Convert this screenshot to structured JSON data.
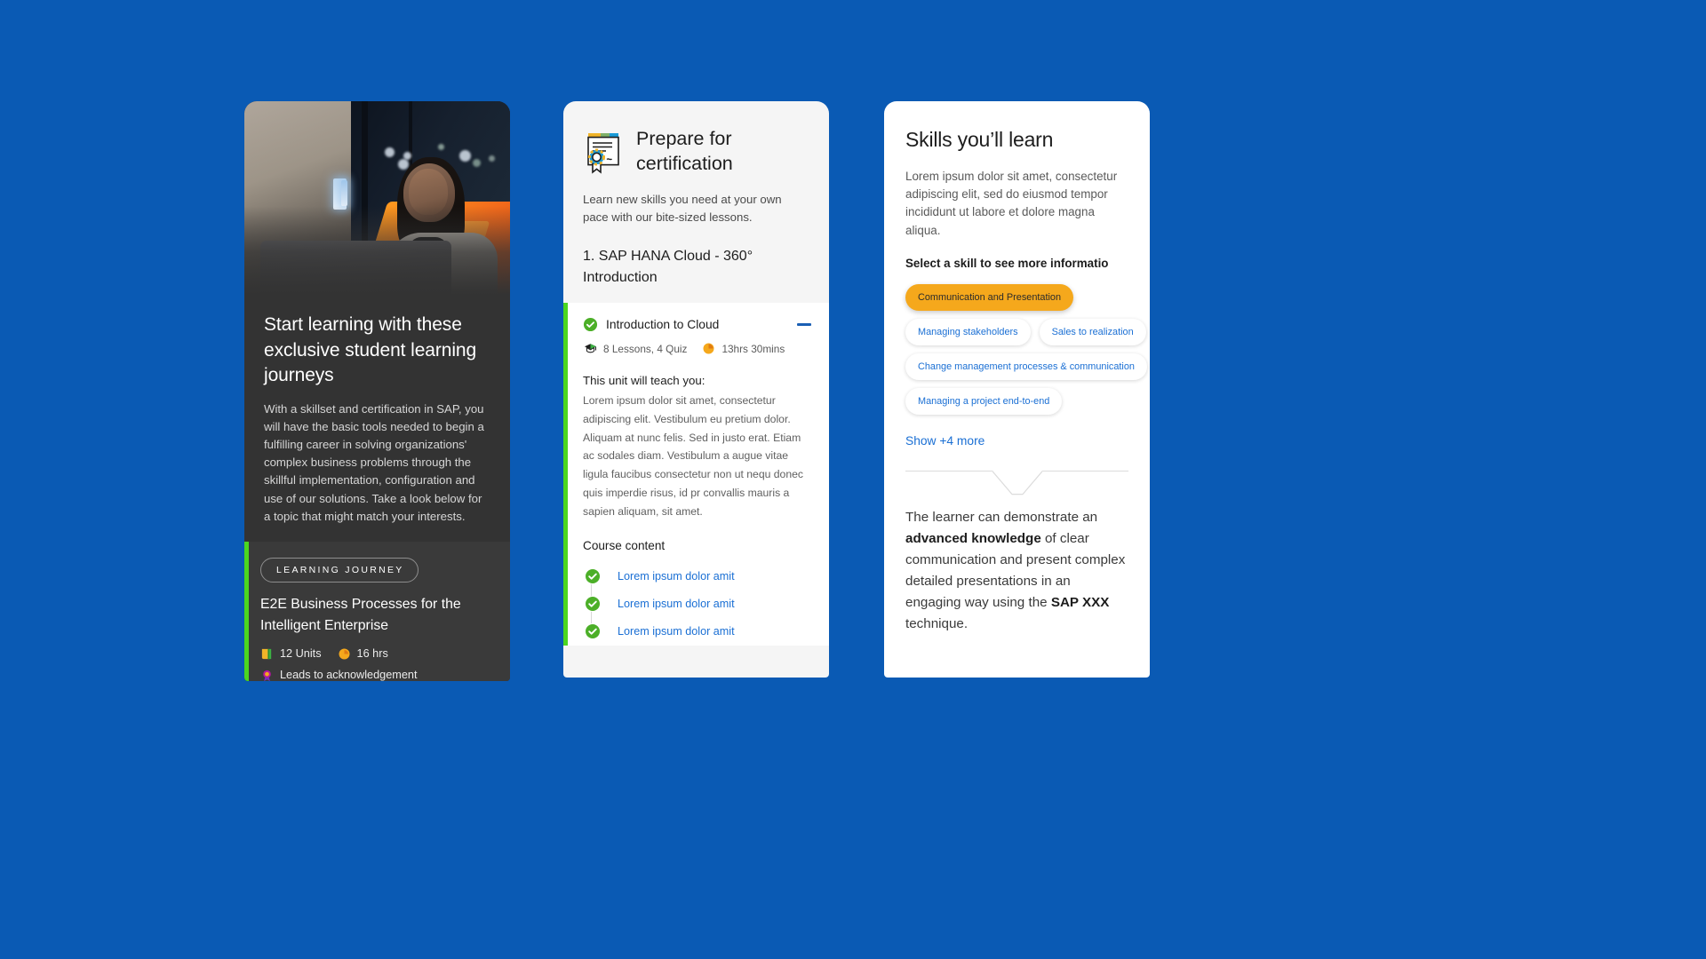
{
  "theme": {
    "background": "#0a5ab4",
    "accent_green": "#4bd61f",
    "link_blue": "#1a6fd4",
    "selected_pill": "#f5a81c",
    "dark_card": "#333333"
  },
  "card_journey": {
    "hero_alt": "student working on laptop at night",
    "title": "Start learning with these exclusive student learning journeys",
    "paragraph": "With a skillset and certification in SAP, you will have the basic tools needed to begin a fulfilling career in solving organizations' complex business problems through the skillful implementation, configuration and use of our solutions. Take a look below for a topic that might match your interests.",
    "badge_label": "LEARNING JOURNEY",
    "journey_title": "E2E Business Processes for the Intelligent Enterprise",
    "units_label": "12 Units",
    "hours_label": "16 hrs",
    "acknowledgement_label": "Leads to acknowledgement"
  },
  "card_certification": {
    "title": "Prepare for certification",
    "subtitle": "Learn new skills you need at your own pace with our bite-sized lessons.",
    "course_number_title": "1. SAP HANA Cloud - 360° Introduction",
    "unit": {
      "name": "Introduction to Cloud",
      "lessons_label": "8 Lessons, 4 Quiz",
      "duration_label": "13hrs 30mins",
      "teach_heading": "This unit will teach you:",
      "teach_body": "Lorem ipsum dolor sit amet, consectetur adipiscing elit. Vestibulum eu pretium dolor. Aliquam at nunc felis. Sed in justo erat. Etiam ac sodales diam. Vestibulum a augue vitae ligula faucibus consectetur non ut nequ donec quis imperdie risus, id pr convallis mauris a sapien aliquam, sit amet.",
      "content_heading": "Course content",
      "content_items": [
        "Lorem ipsum dolor amit",
        "Lorem ipsum dolor amit",
        "Lorem ipsum dolor amit"
      ]
    }
  },
  "card_skills": {
    "title": "Skills you’ll learn",
    "paragraph": "Lorem ipsum dolor sit amet, consectetur adipiscing elit, sed do eiusmod tempor incididunt ut labore et dolore magna aliqua.",
    "select_prompt": "Select a skill to see more informatio",
    "skills": [
      {
        "label": "Communication and Presentation",
        "selected": true
      },
      {
        "label": "Managing stakeholders",
        "selected": false
      },
      {
        "label": "Sales to realization",
        "selected": false
      },
      {
        "label": "Change management processes & communication",
        "selected": false
      },
      {
        "label": "Managing a project end-to-end",
        "selected": false
      }
    ],
    "show_more_label": "Show +4 more",
    "description_parts": {
      "p1": "The learner can demonstrate an ",
      "b1": "advanced knowledge",
      "p2": " of clear communication and present complex detailed presentations in an engaging way using the ",
      "b2": "SAP XXX",
      "p3": " technique."
    }
  }
}
